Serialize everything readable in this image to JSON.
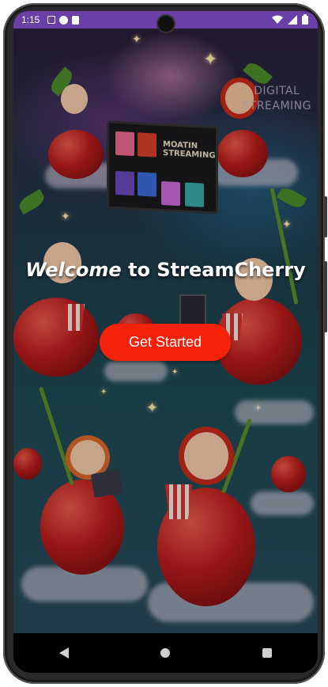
{
  "status_bar": {
    "time": "1:15",
    "icons_left": [
      "nav-a-icon",
      "play-icon",
      "sd-card-icon"
    ],
    "icons_right": [
      "wifi-icon",
      "signal-icon",
      "battery-icon"
    ],
    "background_color": "#6a3fa8"
  },
  "hero": {
    "title_part1": "Welcome",
    "title_part2": "to StreamCherry",
    "button_label": "Get Started",
    "button_color": "#f6210a",
    "artwork_text": {
      "tv_line1": "MOATIN",
      "tv_line2": "STREAMING",
      "corner_line1": "DIGITAL",
      "corner_line2": "STREAMING"
    }
  },
  "nav_bar": {
    "items": [
      "back-icon",
      "home-icon",
      "recents-icon"
    ]
  }
}
